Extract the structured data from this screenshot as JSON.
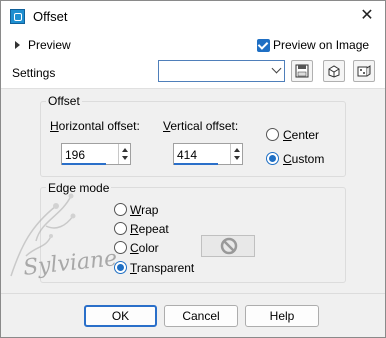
{
  "window": {
    "title": "Offset"
  },
  "header": {
    "preview_label": "Preview",
    "preview_on_image_label": "Preview on Image",
    "preview_on_image_checked": true,
    "settings_label": "Settings",
    "settings_value": ""
  },
  "offset_group": {
    "title": "Offset",
    "horizontal_label_key": "H",
    "horizontal_label_rest": "orizontal offset:",
    "horizontal_value": "196",
    "vertical_label_key": "V",
    "vertical_label_rest": "ertical offset:",
    "vertical_value": "414",
    "center_label_key": "C",
    "center_label_rest": "enter",
    "custom_label_key": "C",
    "custom_label_rest": "ustom",
    "selected": "Custom"
  },
  "edge_group": {
    "title": "Edge mode",
    "options": [
      {
        "key": "W",
        "rest": "rap"
      },
      {
        "key": "R",
        "rest": "epeat"
      },
      {
        "key": "C",
        "rest": "olor"
      },
      {
        "key": "T",
        "rest": "ransparent"
      }
    ],
    "selected": "Transparent"
  },
  "watermark_text": "Sylviane",
  "buttons": {
    "ok": "OK",
    "cancel": "Cancel",
    "help": "Help"
  },
  "colors": {
    "accent": "#1f6fc4",
    "focus_border": "#2a6fc9"
  },
  "icons": {
    "close": "close-icon",
    "save": "save-preset-icon",
    "reset": "reset-icon",
    "randomize": "randomize-icon",
    "disabled": "no-color-icon"
  }
}
